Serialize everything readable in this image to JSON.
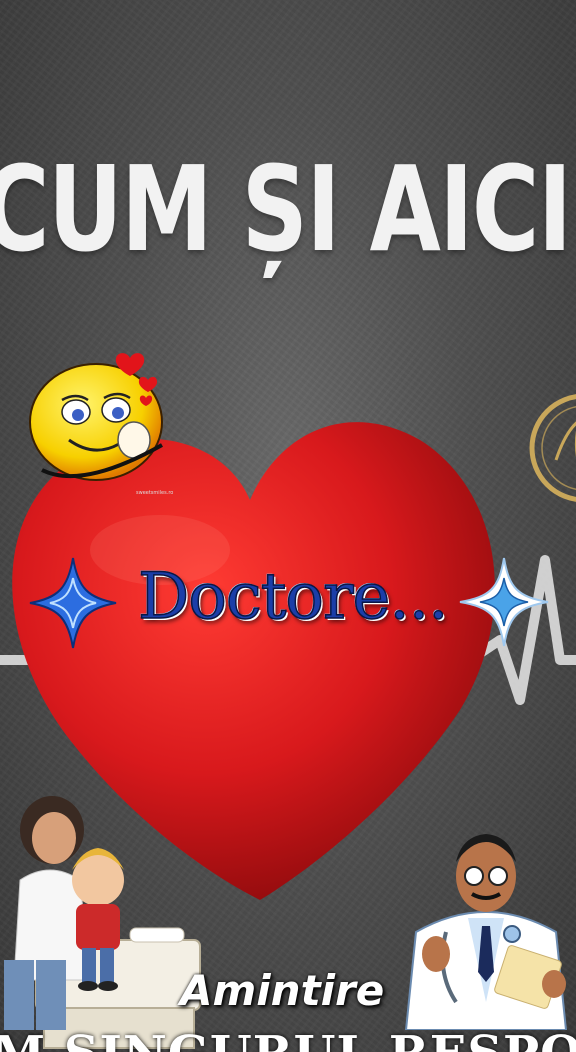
{
  "headline": "CUM ȘI AICI",
  "overlay_title": "Doctore...",
  "caption": "Amintire",
  "bottom_text": "M SINGURUL RESPONS",
  "watermark": "sweetsmiles.ro",
  "icons": {
    "heart": "heart-icon",
    "smiley": "love-smiley-icon",
    "star_left": "sparkle-star-icon",
    "star_right": "sparkle-star-icon",
    "pulse": "heartbeat-line-icon",
    "doctor": "doctor-icon",
    "nurse": "nurse-child-icon",
    "seal": "logo-seal-icon"
  },
  "colors": {
    "heart": "#d8191c",
    "overlay_title": "#1b3ea8",
    "headline": "#f2f2f2",
    "background": "#555555"
  }
}
